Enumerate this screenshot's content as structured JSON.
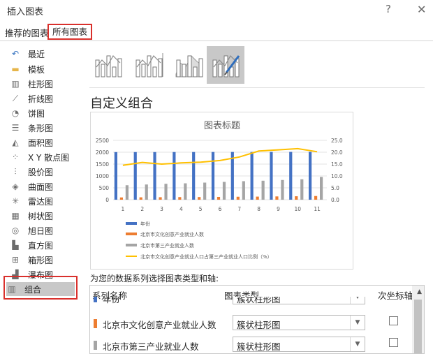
{
  "dialog": {
    "title": "插入图表",
    "help_label": "?",
    "close_label": "✕"
  },
  "tabs": [
    {
      "label": "推荐的图表",
      "selected": false
    },
    {
      "label": "所有图表",
      "selected": true
    }
  ],
  "sidebar": {
    "items": [
      {
        "label": "最近",
        "icon": "recent-icon",
        "glyph": "↶"
      },
      {
        "label": "模板",
        "icon": "folder-icon",
        "glyph": "▬"
      },
      {
        "label": "柱形图",
        "icon": "column-chart-icon",
        "glyph": "▥"
      },
      {
        "label": "折线图",
        "icon": "line-chart-icon",
        "glyph": "⟋"
      },
      {
        "label": "饼图",
        "icon": "pie-chart-icon",
        "glyph": "◔"
      },
      {
        "label": "条形图",
        "icon": "bar-chart-icon",
        "glyph": "☰"
      },
      {
        "label": "面积图",
        "icon": "area-chart-icon",
        "glyph": "◭"
      },
      {
        "label": "X Y 散点图",
        "icon": "scatter-chart-icon",
        "glyph": "⁘"
      },
      {
        "label": "股价图",
        "icon": "stock-chart-icon",
        "glyph": "⫶"
      },
      {
        "label": "曲面图",
        "icon": "surface-chart-icon",
        "glyph": "◈"
      },
      {
        "label": "雷达图",
        "icon": "radar-chart-icon",
        "glyph": "✳"
      },
      {
        "label": "树状图",
        "icon": "treemap-chart-icon",
        "glyph": "▦"
      },
      {
        "label": "旭日图",
        "icon": "sunburst-chart-icon",
        "glyph": "◎"
      },
      {
        "label": "直方图",
        "icon": "histogram-chart-icon",
        "glyph": "▙"
      },
      {
        "label": "箱形图",
        "icon": "box-whisker-chart-icon",
        "glyph": "⊞"
      },
      {
        "label": "瀑布图",
        "icon": "waterfall-chart-icon",
        "glyph": "▟"
      },
      {
        "label": "组合",
        "icon": "combo-chart-icon",
        "glyph": "▥",
        "selected": true
      }
    ]
  },
  "subtypes": [
    {
      "icon": "clustered-column-line-icon",
      "selected": false
    },
    {
      "icon": "clustered-column-line-secondary-axis-icon",
      "selected": false
    },
    {
      "icon": "stacked-area-clustered-column-icon",
      "selected": false
    },
    {
      "icon": "custom-combination-icon",
      "selected": true
    }
  ],
  "section_title": "自定义组合",
  "chart_data": {
    "type": "bar",
    "title": "图表标题",
    "categories": [
      "1",
      "2",
      "3",
      "4",
      "5",
      "6",
      "7",
      "8",
      "9",
      "10",
      "11"
    ],
    "y_ticks": [
      "2500",
      "2000",
      "1500",
      "1000",
      "500",
      "0"
    ],
    "y2_ticks": [
      "25.0",
      "20.0",
      "15.0",
      "10.0",
      "5.0",
      "0.0"
    ],
    "ylim": [
      0,
      2500
    ],
    "y2lim": [
      0,
      25
    ],
    "grid": true,
    "legend_position": "bottom-left",
    "series": [
      {
        "name": "年份",
        "type": "bar",
        "axis": "primary",
        "color": "#4472c4",
        "values": [
          2005,
          2006,
          2007,
          2008,
          2009,
          2010,
          2011,
          2012,
          2013,
          2014,
          2015
        ]
      },
      {
        "name": "北京市文化创意产业就业人数",
        "type": "bar",
        "axis": "primary",
        "color": "#ed7d31",
        "values": [
          95,
          100,
          105,
          110,
          112,
          118,
          125,
          130,
          138,
          145,
          155
        ]
      },
      {
        "name": "北京市第三产业就业人数",
        "type": "bar",
        "axis": "primary",
        "color": "#a5a5a5",
        "values": [
          610,
          640,
          670,
          690,
          720,
          750,
          780,
          800,
          830,
          860,
          960
        ]
      },
      {
        "name": "北京市文化创意产业就业人口占第三产业就业人口比例（%）",
        "type": "line",
        "axis": "secondary",
        "color": "#ffc000",
        "values": [
          14.5,
          15.7,
          15.0,
          15.5,
          15.8,
          16.5,
          18.0,
          20.5,
          21.0,
          21.5,
          20.2
        ]
      }
    ]
  },
  "series_prompt": "为您的数据系列选择图表类型和轴:",
  "table": {
    "headers": {
      "name": "系列名称",
      "type": "图表类型",
      "axis": "次坐标轴"
    },
    "rows": [
      {
        "name": "年份",
        "type": "簇状柱形图",
        "color": "#4472c4",
        "secondary": false
      },
      {
        "name": "北京市文化创意产业就业人数",
        "type": "簇状柱形图",
        "color": "#ed7d31",
        "secondary": false
      },
      {
        "name": "北京市第三产业就业人数",
        "type": "簇状柱形图",
        "color": "#a5a5a5",
        "secondary": false
      }
    ]
  }
}
